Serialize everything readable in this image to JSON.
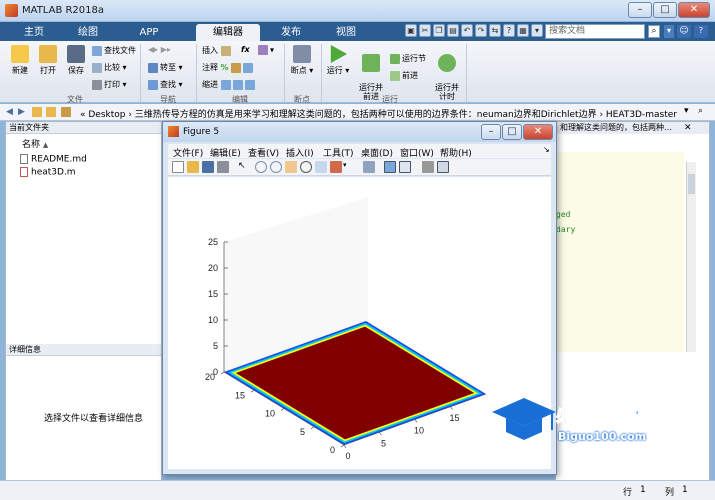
{
  "app": {
    "title": "MATLAB R2018a"
  },
  "window_controls": {
    "minimize": "–",
    "maximize": "□",
    "close": "✕"
  },
  "tabs": [
    {
      "label": "主页"
    },
    {
      "label": "绘图"
    },
    {
      "label": "APP"
    },
    {
      "label": "编辑器",
      "active": true
    },
    {
      "label": "发布"
    },
    {
      "label": "视图"
    }
  ],
  "search": {
    "placeholder": "搜索文档"
  },
  "ribbon": {
    "file_group": {
      "label": "文件",
      "new": "新建",
      "open": "打开",
      "save": "保存",
      "find_file": "查找文件",
      "compare": "比较",
      "print": "打印"
    },
    "nav_group": {
      "label": "导航",
      "goto": "转至",
      "find": "查找"
    },
    "edit_group": {
      "label": "编辑",
      "insert": "插入",
      "comment": "注释",
      "indent": "缩进",
      "fx": "fx"
    },
    "breakpoint_group": {
      "label": "断点",
      "breakpoints": "断点"
    },
    "run_group": {
      "label": "运行",
      "run": "运行",
      "run_advance": "运行并\n前进",
      "run_section": "运行节",
      "advance": "前进",
      "run_time": "运行并\n计时"
    }
  },
  "address": {
    "path": "«  Desktop  ›  三维热传导方程的仿真是用来学习和理解这类问题的，包括两种可以使用的边界条件：neuman边界和Dirichlet边界  ›  HEAT3D-master"
  },
  "current_folder": {
    "title": "当前文件夹",
    "column": "名称",
    "sort": "▲",
    "files": [
      "README.md",
      "heat3D.m"
    ]
  },
  "details": {
    "title": "详细信息",
    "message": "选择文件以查看详细信息"
  },
  "editor_tail": {
    "text": "和理解这类问题的，包括两种…",
    "code1": "ged",
    "code2": "dary"
  },
  "figure": {
    "title": "Figure 5",
    "menu": [
      "文件(F)",
      "编辑(E)",
      "查看(V)",
      "插入(I)",
      "工具(T)",
      "桌面(D)",
      "窗口(W)",
      "帮助(H)"
    ],
    "colors": {
      "surface": "#800000",
      "edge_inner": "#ffff00",
      "edge_mid": "#00c8ff",
      "edge_outer": "#1f4fd8"
    }
  },
  "chart_data": {
    "type": "surface",
    "x": [
      0,
      20
    ],
    "y": [
      0,
      20
    ],
    "z": 0,
    "zlim": [
      0,
      25
    ],
    "z_ticks": [
      0,
      5,
      10,
      15,
      20,
      25
    ],
    "x_ticks": [
      0,
      5,
      10,
      15
    ],
    "y_ticks": [
      0,
      5,
      10,
      15,
      20
    ],
    "grid": false
  },
  "status": {
    "row_label": "行",
    "row": "1",
    "col_label": "列",
    "col": "1"
  },
  "watermark": {
    "text": "必过源码",
    "sub": "Biguo100.com"
  }
}
